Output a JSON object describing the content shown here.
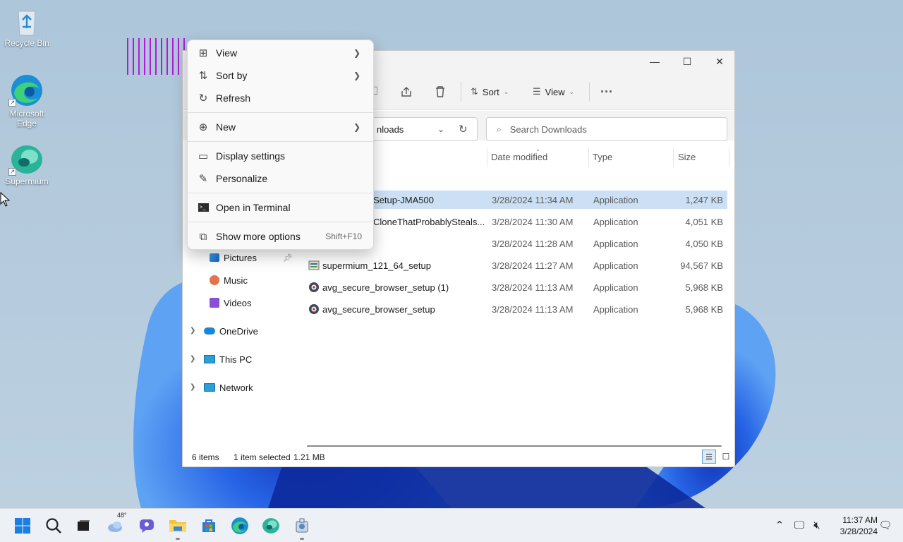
{
  "desktop": {
    "icons": [
      {
        "label": "Recycle Bin",
        "icon": "recycle-bin-icon"
      },
      {
        "label": "Microsoft Edge",
        "icon": "edge-icon"
      },
      {
        "label": "Supermium",
        "icon": "supermium-icon"
      }
    ]
  },
  "explorer": {
    "toolbar": {
      "sort_label": "Sort",
      "view_label": "View"
    },
    "address": {
      "path_fragment": "nloads",
      "search_placeholder": "Search Downloads"
    },
    "nav": {
      "items": [
        {
          "label": "Pictures",
          "icon": "pictures-icon",
          "pinned": true
        },
        {
          "label": "Music",
          "icon": "music-icon",
          "pinned": false
        },
        {
          "label": "Videos",
          "icon": "videos-icon",
          "pinned": false
        },
        {
          "label": "OneDrive",
          "icon": "onedrive-icon",
          "expandable": true
        },
        {
          "label": "This PC",
          "icon": "this-pc-icon",
          "expandable": true
        },
        {
          "label": "Network",
          "icon": "network-icon",
          "expandable": true
        }
      ]
    },
    "columns": {
      "date": "Date modified",
      "type": "Type",
      "size": "Size"
    },
    "files": [
      {
        "name": "Setup-JMA500",
        "date": "3/28/2024 11:34 AM",
        "type": "Application",
        "size": "1,247 KB",
        "selected": true
      },
      {
        "name": "CloneThatProbablySteals...",
        "date": "3/28/2024 11:30 AM",
        "type": "Application",
        "size": "4,051 KB",
        "selected": false
      },
      {
        "name": "",
        "date": "3/28/2024 11:28 AM",
        "type": "Application",
        "size": "4,050 KB",
        "selected": false
      },
      {
        "name": "supermium_121_64_setup",
        "date": "3/28/2024 11:27 AM",
        "type": "Application",
        "size": "94,567 KB",
        "selected": false
      },
      {
        "name": "avg_secure_browser_setup (1)",
        "date": "3/28/2024 11:13 AM",
        "type": "Application",
        "size": "5,968 KB",
        "selected": false
      },
      {
        "name": "avg_secure_browser_setup",
        "date": "3/28/2024 11:13 AM",
        "type": "Application",
        "size": "5,968 KB",
        "selected": false
      }
    ],
    "status": {
      "count": "6 items",
      "selection": "1 item selected",
      "selection_size": "1.21 MB"
    }
  },
  "context_menu": {
    "items": [
      {
        "label": "View",
        "icon": "view-grid-icon",
        "submenu": true
      },
      {
        "label": "Sort by",
        "icon": "sort-icon",
        "submenu": true
      },
      {
        "label": "Refresh",
        "icon": "refresh-icon",
        "submenu": false
      },
      {
        "label": "New",
        "icon": "new-plus-icon",
        "submenu": true
      },
      {
        "label": "Display settings",
        "icon": "display-settings-icon",
        "submenu": false
      },
      {
        "label": "Personalize",
        "icon": "personalize-brush-icon",
        "submenu": false
      },
      {
        "label": "Open in Terminal",
        "icon": "terminal-icon",
        "submenu": false
      },
      {
        "label": "Show more options",
        "icon": "more-options-icon",
        "shortcut": "Shift+F10"
      }
    ]
  },
  "taskbar": {
    "weather_temp": "48°",
    "clock_time": "11:37 AM",
    "clock_date": "3/28/2024"
  },
  "colors": {
    "accent": "#0067c0",
    "selection": "#cce0f5",
    "taskbar": "#edf0f4"
  }
}
